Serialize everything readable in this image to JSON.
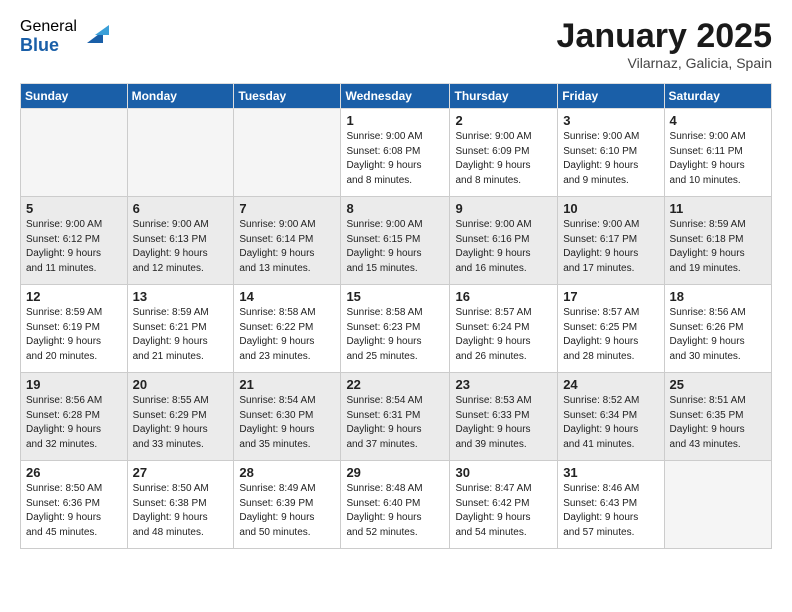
{
  "logo": {
    "general": "General",
    "blue": "Blue"
  },
  "title": "January 2025",
  "subtitle": "Vilarnaz, Galicia, Spain",
  "days_of_week": [
    "Sunday",
    "Monday",
    "Tuesday",
    "Wednesday",
    "Thursday",
    "Friday",
    "Saturday"
  ],
  "weeks": [
    {
      "shaded": false,
      "days": [
        {
          "number": "",
          "info": ""
        },
        {
          "number": "",
          "info": ""
        },
        {
          "number": "",
          "info": ""
        },
        {
          "number": "1",
          "info": "Sunrise: 9:00 AM\nSunset: 6:08 PM\nDaylight: 9 hours\nand 8 minutes."
        },
        {
          "number": "2",
          "info": "Sunrise: 9:00 AM\nSunset: 6:09 PM\nDaylight: 9 hours\nand 8 minutes."
        },
        {
          "number": "3",
          "info": "Sunrise: 9:00 AM\nSunset: 6:10 PM\nDaylight: 9 hours\nand 9 minutes."
        },
        {
          "number": "4",
          "info": "Sunrise: 9:00 AM\nSunset: 6:11 PM\nDaylight: 9 hours\nand 10 minutes."
        }
      ]
    },
    {
      "shaded": true,
      "days": [
        {
          "number": "5",
          "info": "Sunrise: 9:00 AM\nSunset: 6:12 PM\nDaylight: 9 hours\nand 11 minutes."
        },
        {
          "number": "6",
          "info": "Sunrise: 9:00 AM\nSunset: 6:13 PM\nDaylight: 9 hours\nand 12 minutes."
        },
        {
          "number": "7",
          "info": "Sunrise: 9:00 AM\nSunset: 6:14 PM\nDaylight: 9 hours\nand 13 minutes."
        },
        {
          "number": "8",
          "info": "Sunrise: 9:00 AM\nSunset: 6:15 PM\nDaylight: 9 hours\nand 15 minutes."
        },
        {
          "number": "9",
          "info": "Sunrise: 9:00 AM\nSunset: 6:16 PM\nDaylight: 9 hours\nand 16 minutes."
        },
        {
          "number": "10",
          "info": "Sunrise: 9:00 AM\nSunset: 6:17 PM\nDaylight: 9 hours\nand 17 minutes."
        },
        {
          "number": "11",
          "info": "Sunrise: 8:59 AM\nSunset: 6:18 PM\nDaylight: 9 hours\nand 19 minutes."
        }
      ]
    },
    {
      "shaded": false,
      "days": [
        {
          "number": "12",
          "info": "Sunrise: 8:59 AM\nSunset: 6:19 PM\nDaylight: 9 hours\nand 20 minutes."
        },
        {
          "number": "13",
          "info": "Sunrise: 8:59 AM\nSunset: 6:21 PM\nDaylight: 9 hours\nand 21 minutes."
        },
        {
          "number": "14",
          "info": "Sunrise: 8:58 AM\nSunset: 6:22 PM\nDaylight: 9 hours\nand 23 minutes."
        },
        {
          "number": "15",
          "info": "Sunrise: 8:58 AM\nSunset: 6:23 PM\nDaylight: 9 hours\nand 25 minutes."
        },
        {
          "number": "16",
          "info": "Sunrise: 8:57 AM\nSunset: 6:24 PM\nDaylight: 9 hours\nand 26 minutes."
        },
        {
          "number": "17",
          "info": "Sunrise: 8:57 AM\nSunset: 6:25 PM\nDaylight: 9 hours\nand 28 minutes."
        },
        {
          "number": "18",
          "info": "Sunrise: 8:56 AM\nSunset: 6:26 PM\nDaylight: 9 hours\nand 30 minutes."
        }
      ]
    },
    {
      "shaded": true,
      "days": [
        {
          "number": "19",
          "info": "Sunrise: 8:56 AM\nSunset: 6:28 PM\nDaylight: 9 hours\nand 32 minutes."
        },
        {
          "number": "20",
          "info": "Sunrise: 8:55 AM\nSunset: 6:29 PM\nDaylight: 9 hours\nand 33 minutes."
        },
        {
          "number": "21",
          "info": "Sunrise: 8:54 AM\nSunset: 6:30 PM\nDaylight: 9 hours\nand 35 minutes."
        },
        {
          "number": "22",
          "info": "Sunrise: 8:54 AM\nSunset: 6:31 PM\nDaylight: 9 hours\nand 37 minutes."
        },
        {
          "number": "23",
          "info": "Sunrise: 8:53 AM\nSunset: 6:33 PM\nDaylight: 9 hours\nand 39 minutes."
        },
        {
          "number": "24",
          "info": "Sunrise: 8:52 AM\nSunset: 6:34 PM\nDaylight: 9 hours\nand 41 minutes."
        },
        {
          "number": "25",
          "info": "Sunrise: 8:51 AM\nSunset: 6:35 PM\nDaylight: 9 hours\nand 43 minutes."
        }
      ]
    },
    {
      "shaded": false,
      "days": [
        {
          "number": "26",
          "info": "Sunrise: 8:50 AM\nSunset: 6:36 PM\nDaylight: 9 hours\nand 45 minutes."
        },
        {
          "number": "27",
          "info": "Sunrise: 8:50 AM\nSunset: 6:38 PM\nDaylight: 9 hours\nand 48 minutes."
        },
        {
          "number": "28",
          "info": "Sunrise: 8:49 AM\nSunset: 6:39 PM\nDaylight: 9 hours\nand 50 minutes."
        },
        {
          "number": "29",
          "info": "Sunrise: 8:48 AM\nSunset: 6:40 PM\nDaylight: 9 hours\nand 52 minutes."
        },
        {
          "number": "30",
          "info": "Sunrise: 8:47 AM\nSunset: 6:42 PM\nDaylight: 9 hours\nand 54 minutes."
        },
        {
          "number": "31",
          "info": "Sunrise: 8:46 AM\nSunset: 6:43 PM\nDaylight: 9 hours\nand 57 minutes."
        },
        {
          "number": "",
          "info": ""
        }
      ]
    }
  ]
}
